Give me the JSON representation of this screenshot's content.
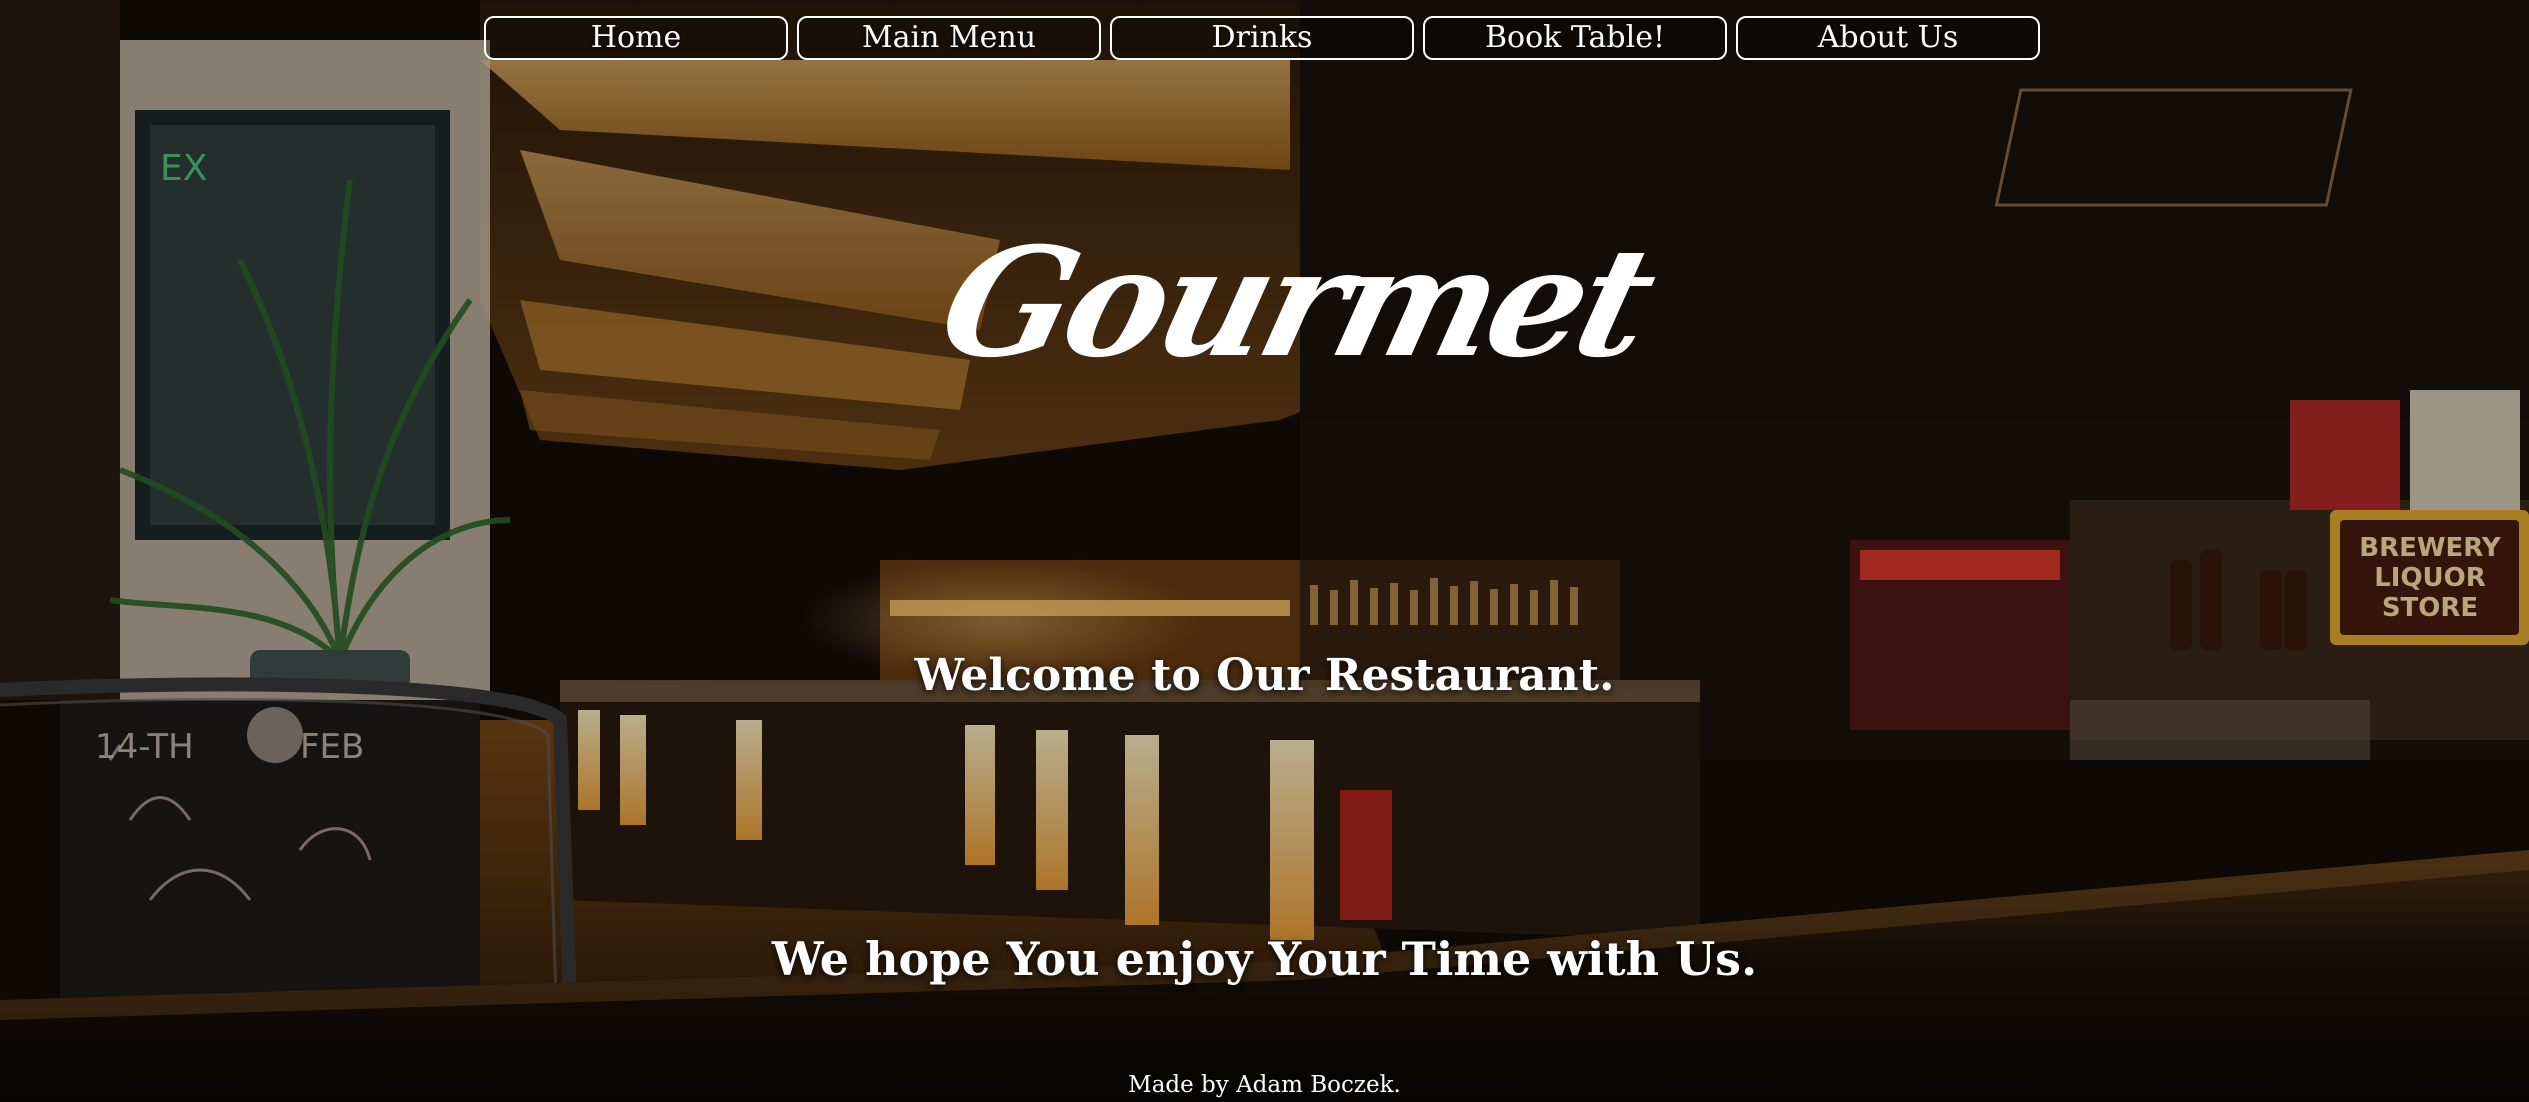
{
  "nav": {
    "items": [
      {
        "label": "Home"
      },
      {
        "label": "Main Menu"
      },
      {
        "label": "Drinks"
      },
      {
        "label": "Book Table!"
      },
      {
        "label": "About Us"
      }
    ]
  },
  "hero": {
    "logo_text": "Gourmet",
    "welcome": "Welcome to Our Restaurant.",
    "tagline": "We hope You enjoy Your Time with Us."
  },
  "footer": {
    "credit": "Made by Adam Boczek."
  },
  "background": {
    "scene": "restaurant-bar-interior-photo",
    "signs": {
      "exit_sign": "EX",
      "chalkboard_date": "14-TH FEB",
      "store_sign": "BREWERY LIQUOR STORE"
    }
  },
  "colors": {
    "text": "#ffffff",
    "nav_border": "#ffffff",
    "warm_light": "#f3a640",
    "dark_bg": "#0b0806"
  }
}
